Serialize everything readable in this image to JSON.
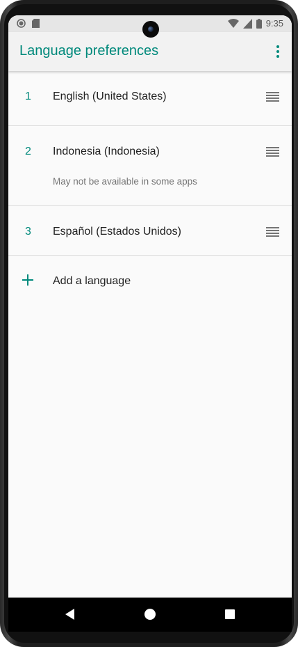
{
  "statusbar": {
    "time": "9:35"
  },
  "appbar": {
    "title": "Language preferences"
  },
  "languages": [
    {
      "number": "1",
      "label": "English (United States)"
    },
    {
      "number": "2",
      "label": "Indonesia (Indonesia)",
      "note": "May not be available in some apps"
    },
    {
      "number": "3",
      "label": "Español (Estados Unidos)"
    }
  ],
  "add_language": {
    "label": "Add a language"
  },
  "colors": {
    "accent": "#00897b",
    "background": "#fafafa",
    "appbar": "#f2f2f2"
  }
}
